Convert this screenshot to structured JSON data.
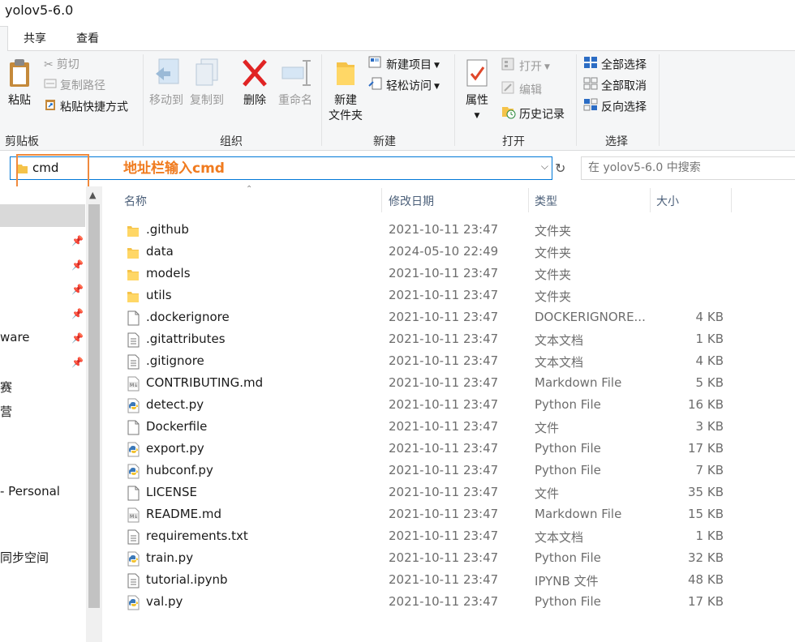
{
  "window": {
    "title": "yolov5-6.0"
  },
  "tabs": {
    "share": "共享",
    "view": "查看"
  },
  "ribbon": {
    "clipboard": {
      "label": "剪贴板",
      "paste": "粘贴",
      "cut": "剪切",
      "copy_path": "复制路径",
      "paste_shortcut": "粘贴快捷方式"
    },
    "organize": {
      "label": "组织",
      "move_to": "移动到",
      "copy_to": "复制到",
      "delete": "删除",
      "rename": "重命名"
    },
    "new": {
      "label": "新建",
      "new_folder_line1": "新建",
      "new_folder_line2": "文件夹",
      "new_item": "新建项目",
      "easy_access": "轻松访问"
    },
    "open": {
      "label": "打开",
      "properties": "属性",
      "open": "打开",
      "edit": "编辑",
      "history": "历史记录"
    },
    "select": {
      "label": "选择",
      "select_all": "全部选择",
      "select_none": "全部取消",
      "invert": "反向选择"
    }
  },
  "address": {
    "value": "cmd",
    "search_placeholder": "在 yolov5-6.0 中搜索",
    "annotation": "地址栏输入cmd"
  },
  "nav": {
    "items": [
      {
        "text": "ware",
        "pinned": true
      },
      {
        "text": "赛",
        "pinned": false
      },
      {
        "text": "营",
        "pinned": false
      },
      {
        "text": "- Personal",
        "pinned": false
      },
      {
        "text": "同步空间",
        "pinned": false
      }
    ]
  },
  "columns": {
    "name": "名称",
    "date": "修改日期",
    "type": "类型",
    "size": "大小"
  },
  "files": [
    {
      "name": ".github",
      "date": "2021-10-11 23:47",
      "type": "文件夹",
      "size": "",
      "icon": "folder-icon"
    },
    {
      "name": "data",
      "date": "2024-05-10 22:49",
      "type": "文件夹",
      "size": "",
      "icon": "folder-icon"
    },
    {
      "name": "models",
      "date": "2021-10-11 23:47",
      "type": "文件夹",
      "size": "",
      "icon": "folder-icon"
    },
    {
      "name": "utils",
      "date": "2021-10-11 23:47",
      "type": "文件夹",
      "size": "",
      "icon": "folder-icon"
    },
    {
      "name": ".dockerignore",
      "date": "2021-10-11 23:47",
      "type": "DOCKERIGNORE...",
      "size": "4 KB",
      "icon": "blank-file-icon"
    },
    {
      "name": ".gitattributes",
      "date": "2021-10-11 23:47",
      "type": "文本文档",
      "size": "1 KB",
      "icon": "text-file-icon"
    },
    {
      "name": ".gitignore",
      "date": "2021-10-11 23:47",
      "type": "文本文档",
      "size": "4 KB",
      "icon": "text-file-icon"
    },
    {
      "name": "CONTRIBUTING.md",
      "date": "2021-10-11 23:47",
      "type": "Markdown File",
      "size": "5 KB",
      "icon": "markdown-file-icon"
    },
    {
      "name": "detect.py",
      "date": "2021-10-11 23:47",
      "type": "Python File",
      "size": "16 KB",
      "icon": "python-file-icon"
    },
    {
      "name": "Dockerfile",
      "date": "2021-10-11 23:47",
      "type": "文件",
      "size": "3 KB",
      "icon": "blank-file-icon"
    },
    {
      "name": "export.py",
      "date": "2021-10-11 23:47",
      "type": "Python File",
      "size": "17 KB",
      "icon": "python-file-icon"
    },
    {
      "name": "hubconf.py",
      "date": "2021-10-11 23:47",
      "type": "Python File",
      "size": "7 KB",
      "icon": "python-file-icon"
    },
    {
      "name": "LICENSE",
      "date": "2021-10-11 23:47",
      "type": "文件",
      "size": "35 KB",
      "icon": "blank-file-icon"
    },
    {
      "name": "README.md",
      "date": "2021-10-11 23:47",
      "type": "Markdown File",
      "size": "15 KB",
      "icon": "markdown-file-icon"
    },
    {
      "name": "requirements.txt",
      "date": "2021-10-11 23:47",
      "type": "文本文档",
      "size": "1 KB",
      "icon": "text-file-icon"
    },
    {
      "name": "train.py",
      "date": "2021-10-11 23:47",
      "type": "Python File",
      "size": "32 KB",
      "icon": "python-file-icon"
    },
    {
      "name": "tutorial.ipynb",
      "date": "2021-10-11 23:47",
      "type": "IPYNB 文件",
      "size": "48 KB",
      "icon": "text-file-icon"
    },
    {
      "name": "val.py",
      "date": "2021-10-11 23:47",
      "type": "Python File",
      "size": "17 KB",
      "icon": "python-file-icon"
    }
  ]
}
